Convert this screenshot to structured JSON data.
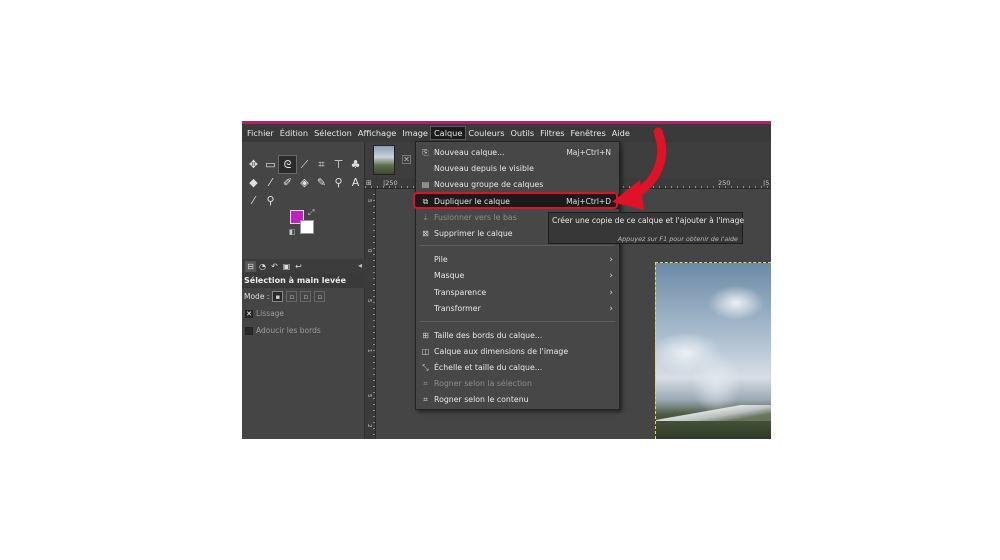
{
  "menubar": {
    "items": [
      {
        "label": "Fichier",
        "active": false
      },
      {
        "label": "Édition",
        "active": false
      },
      {
        "label": "Sélection",
        "active": false
      },
      {
        "label": "Affichage",
        "active": false
      },
      {
        "label": "Image",
        "active": false
      },
      {
        "label": "Calque",
        "active": true
      },
      {
        "label": "Couleurs",
        "active": false
      },
      {
        "label": "Outils",
        "active": false
      },
      {
        "label": "Filtres",
        "active": false
      },
      {
        "label": "Fenêtres",
        "active": false
      },
      {
        "label": "Aide",
        "active": false
      }
    ]
  },
  "toolbox": {
    "row1": [
      "move-tool-icon",
      "rect-select-icon",
      "free-select-icon",
      "fuzzy-select-icon",
      "crop-icon",
      "transform-icon",
      "warp-icon"
    ],
    "row2": [
      "bucket-fill-icon",
      "paintbrush-icon",
      "smudge-icon",
      "eraser-icon",
      "clone-icon",
      "paths-icon",
      "text-icon"
    ],
    "row3": [
      "color-picker-icon",
      "zoom-icon"
    ],
    "foreground_color": "#c020c0",
    "background_color": "#ffffff"
  },
  "tool_options": {
    "title": "Sélection à main levée",
    "mode_label": "Mode :",
    "options": [
      {
        "label": "Lissage",
        "checked": true
      },
      {
        "label": "Adoucir les bords",
        "checked": false
      }
    ]
  },
  "rulers": {
    "h_labels": [
      "|250",
      "|0",
      "250",
      "|5"
    ],
    "v_labels": [
      "5",
      "0",
      "5",
      "1",
      "5",
      "2"
    ]
  },
  "calque_menu": {
    "items": [
      {
        "label": "Nouveau calque...",
        "shortcut": "Maj+Ctrl+N",
        "icon": "new-layer-icon",
        "disabled": false
      },
      {
        "label": "Nouveau depuis le visible",
        "shortcut": "",
        "icon": "",
        "disabled": false
      },
      {
        "label": "Nouveau groupe de calques",
        "shortcut": "",
        "icon": "layer-group-icon",
        "disabled": false
      },
      {
        "label": "Dupliquer le calque",
        "shortcut": "Maj+Ctrl+D",
        "icon": "duplicate-layer-icon",
        "disabled": false,
        "highlighted": true
      },
      {
        "label": "Fusionner vers le bas",
        "shortcut": "",
        "icon": "merge-down-icon",
        "disabled": true
      },
      {
        "label": "Supprimer le calque",
        "shortcut": "",
        "icon": "delete-layer-icon",
        "disabled": false
      },
      {
        "label": "Pile",
        "submenu": true
      },
      {
        "label": "Masque",
        "submenu": true
      },
      {
        "label": "Transparence",
        "submenu": true
      },
      {
        "label": "Transformer",
        "submenu": true
      },
      {
        "label": "Taille des bords du calque...",
        "icon": "layer-boundary-icon",
        "disabled": false
      },
      {
        "label": "Calque aux dimensions de l'image",
        "icon": "layer-to-image-icon",
        "disabled": false
      },
      {
        "label": "Échelle et taille du calque...",
        "icon": "scale-layer-icon",
        "disabled": false
      },
      {
        "label": "Rogner selon la sélection",
        "icon": "crop-to-selection-icon",
        "disabled": true
      },
      {
        "label": "Rogner selon le contenu",
        "icon": "crop-to-content-icon",
        "disabled": false
      }
    ]
  },
  "tooltip": {
    "text": "Créer une copie de ce calque et l'ajouter à l'image",
    "help": "Appuyez sur F1 pour obtenir de l'aide"
  },
  "annotation": {
    "arrow_color": "#e01228"
  }
}
